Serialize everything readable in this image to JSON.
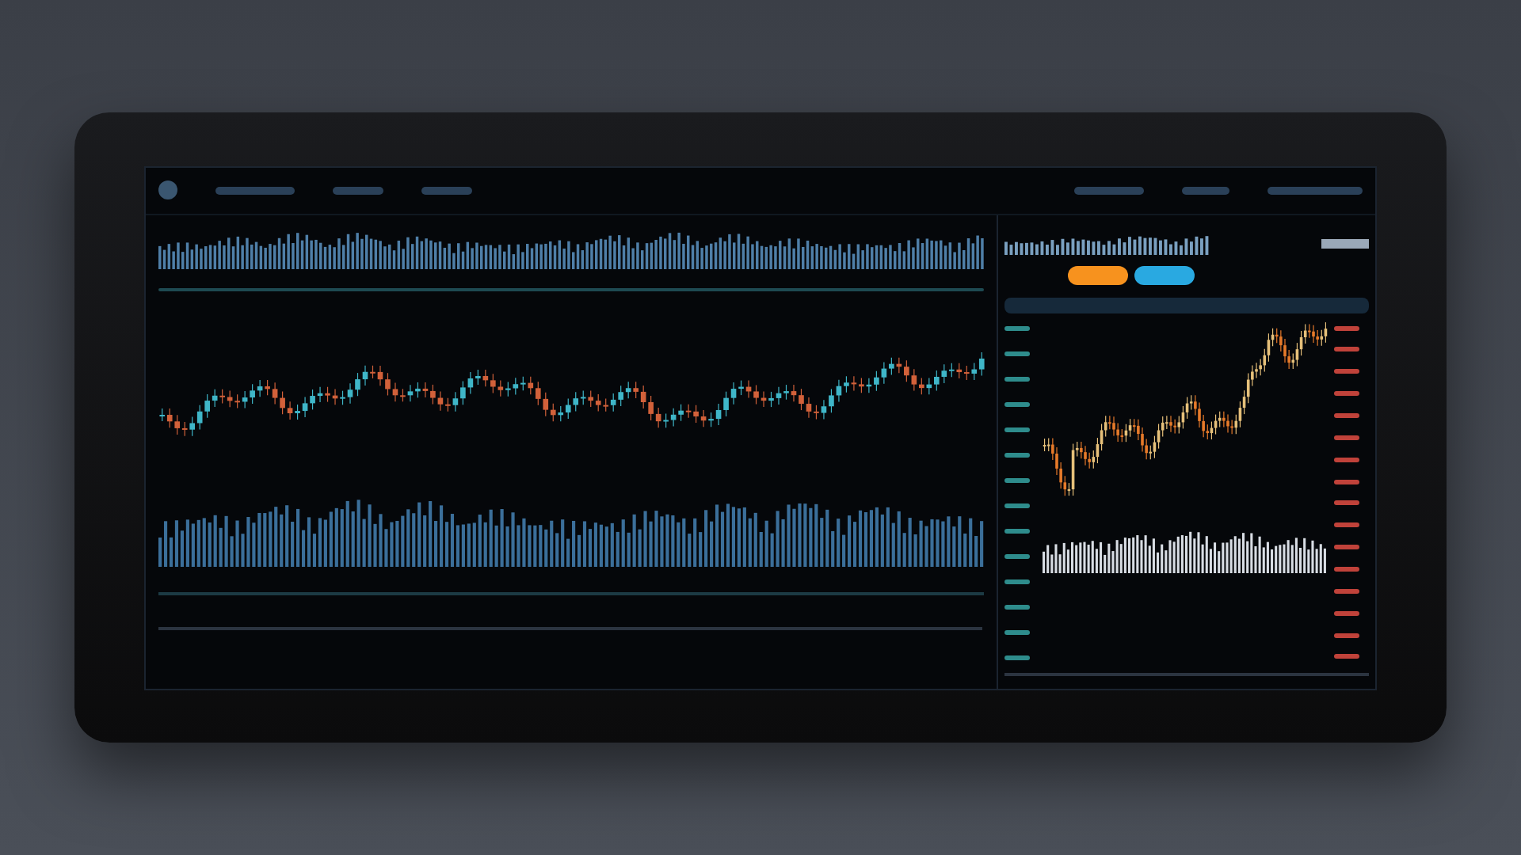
{
  "screen": {
    "buttons": [
      {
        "color": "#f7921e"
      },
      {
        "color": "#29a9e1"
      }
    ]
  }
}
